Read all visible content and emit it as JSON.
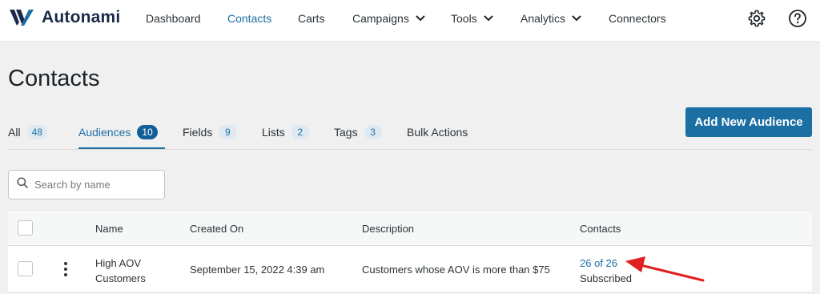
{
  "header": {
    "logo_text": "Autonami",
    "nav": [
      {
        "label": "Dashboard",
        "active": false
      },
      {
        "label": "Contacts",
        "active": true
      },
      {
        "label": "Carts",
        "active": false
      },
      {
        "label": "Campaigns",
        "active": false,
        "dropdown": true
      },
      {
        "label": "Tools",
        "active": false,
        "dropdown": true
      },
      {
        "label": "Analytics",
        "active": false,
        "dropdown": true
      },
      {
        "label": "Connectors",
        "active": false
      }
    ],
    "icons": [
      "gear-icon",
      "help-icon"
    ]
  },
  "page": {
    "title": "Contacts"
  },
  "tabs": [
    {
      "label": "All",
      "count": "48"
    },
    {
      "label": "Audiences",
      "count": "10",
      "active": true
    },
    {
      "label": "Fields",
      "count": "9"
    },
    {
      "label": "Lists",
      "count": "2"
    },
    {
      "label": "Tags",
      "count": "3"
    },
    {
      "label": "Bulk Actions"
    }
  ],
  "actions": {
    "add_label": "Add New Audience"
  },
  "search": {
    "placeholder": "Search by name"
  },
  "table": {
    "columns": [
      "Name",
      "Created On",
      "Description",
      "Contacts"
    ],
    "rows": [
      {
        "name_line1": "High AOV",
        "name_line2": "Customers",
        "created_on": "September 15, 2022 4:39 am",
        "description": "Customers whose AOV is more than $75",
        "contacts_link": "26 of 26",
        "contacts_status": "Subscribed"
      }
    ]
  },
  "colors": {
    "accent": "#1b6fa3",
    "annotation_arrow": "#e02020"
  }
}
